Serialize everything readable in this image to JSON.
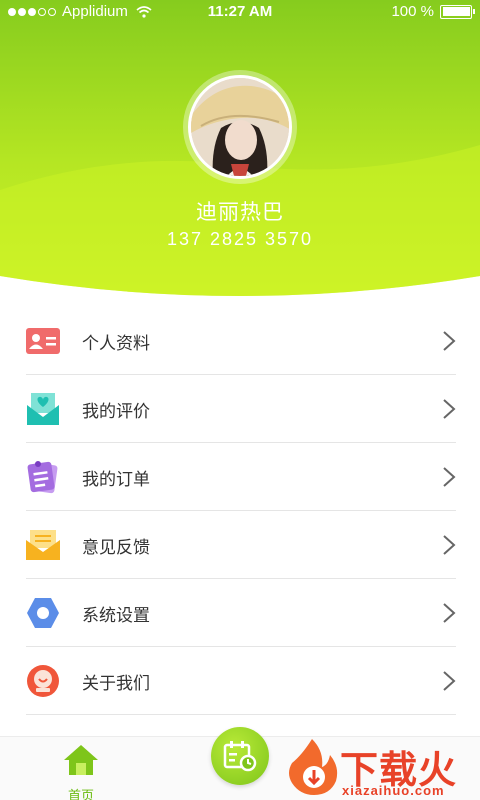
{
  "status_bar": {
    "carrier": "Applidium",
    "time": "11:27 AM",
    "battery": "100 %"
  },
  "profile": {
    "name": "迪丽热巴",
    "phone": "137 2825 3570"
  },
  "colors": {
    "header_top": "#8bd11f",
    "header_bottom": "#d4f427",
    "accent": "#6abb0f",
    "watermark": "#e84228"
  },
  "menu": [
    {
      "label": "个人资料",
      "icon": "id-card-icon",
      "color": "#f06b6b"
    },
    {
      "label": "我的评价",
      "icon": "heart-envelope-icon",
      "color": "#1fbfb1"
    },
    {
      "label": "我的订单",
      "icon": "order-note-icon",
      "color": "#a46ce0"
    },
    {
      "label": "意见反馈",
      "icon": "mail-icon",
      "color": "#f7b21f"
    },
    {
      "label": "系统设置",
      "icon": "settings-hexagon-icon",
      "color": "#5b8de8"
    },
    {
      "label": "关于我们",
      "icon": "about-badge-icon",
      "color": "#f0563a"
    }
  ],
  "tabbar": {
    "home_label": "首页"
  },
  "watermark": {
    "text": "下载火",
    "url": "xiazaihuo.com"
  }
}
